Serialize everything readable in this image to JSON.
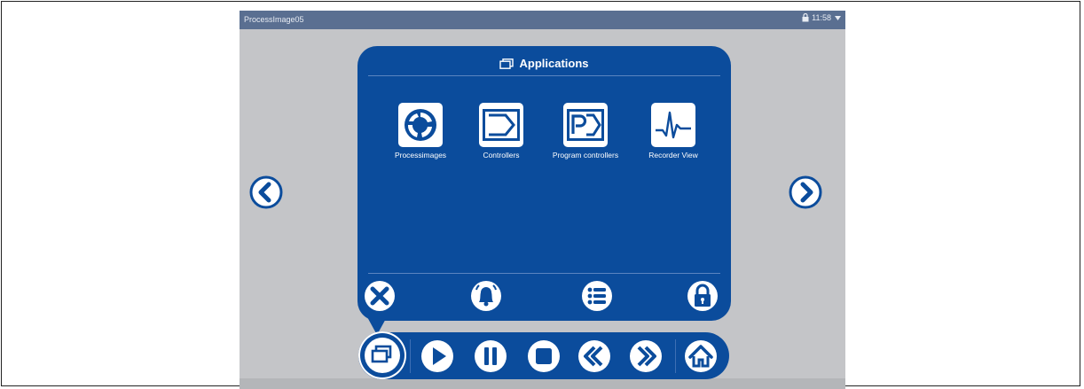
{
  "window": {
    "title": "ProcessImage05",
    "time": "11:58"
  },
  "panel": {
    "title": "Applications",
    "apps": [
      {
        "label": "Processimages",
        "icon": "processimages-icon"
      },
      {
        "label": "Controllers",
        "icon": "controllers-icon"
      },
      {
        "label": "Program controllers",
        "icon": "program-controllers-icon"
      },
      {
        "label": "Recorder View",
        "icon": "recorder-view-icon"
      }
    ],
    "actions": [
      "close-icon",
      "bell-icon",
      "list-icon",
      "lock-icon"
    ]
  },
  "toolbar": {
    "items": [
      "applications-icon",
      "play-icon",
      "pause-icon",
      "stop-icon",
      "rewind-icon",
      "fast-forward-icon",
      "home-icon"
    ]
  },
  "colors": {
    "accent": "#0b4c9c",
    "titlebar": "#5a6f91",
    "background": "#c4c5c8"
  }
}
